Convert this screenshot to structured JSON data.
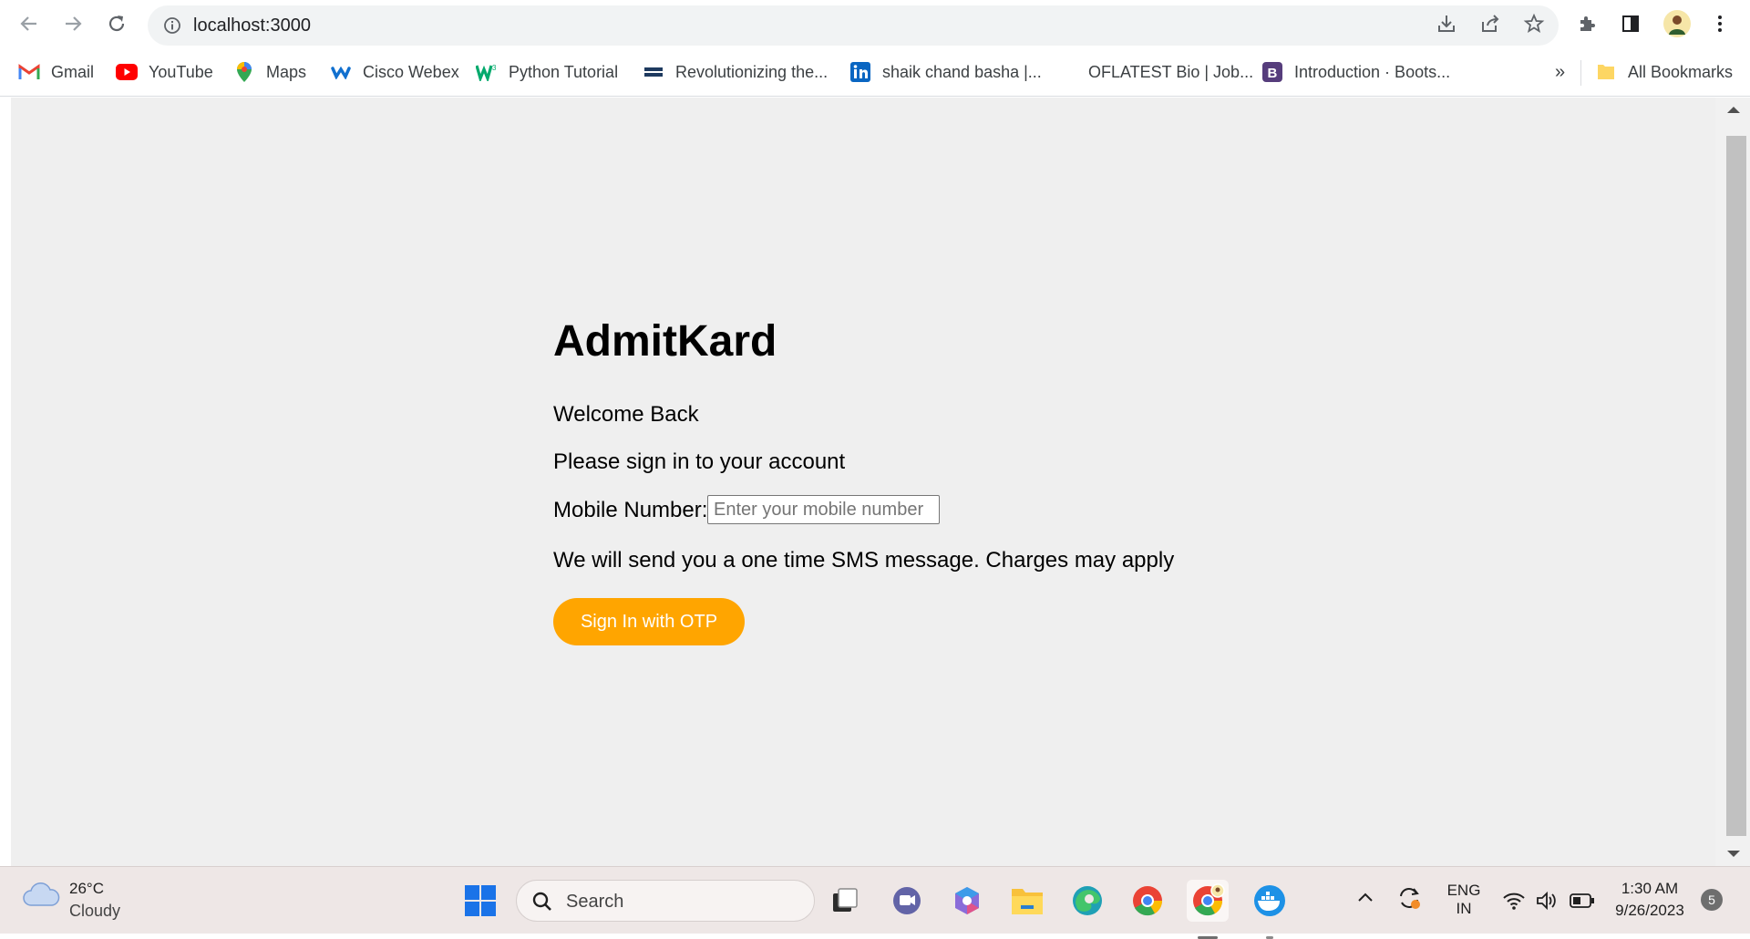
{
  "browser": {
    "url": "localhost:3000",
    "bookmarks": [
      {
        "label": "Gmail",
        "icon": "gmail-icon"
      },
      {
        "label": "YouTube",
        "icon": "youtube-icon"
      },
      {
        "label": "Maps",
        "icon": "maps-icon"
      },
      {
        "label": "Cisco Webex",
        "icon": "webex-icon"
      },
      {
        "label": "Python Tutorial",
        "icon": "w3schools-icon"
      },
      {
        "label": "Revolutionizing the...",
        "icon": "nxtwave-icon"
      },
      {
        "label": "shaik chand basha |...",
        "icon": "linkedin-icon"
      },
      {
        "label": "OFLATEST Bio | Job...",
        "icon": ""
      },
      {
        "label": "Introduction · Boots...",
        "icon": "bootstrap-icon"
      }
    ],
    "more_bookmarks": "»",
    "all_bookmarks": "All Bookmarks"
  },
  "page": {
    "title": "AdmitKard",
    "welcome": "Welcome Back",
    "subtitle": "Please sign in to your account",
    "mobile_label": "Mobile Number:",
    "mobile_value": "",
    "mobile_placeholder": "Enter your mobile number",
    "sms_note": "We will send you a one time SMS message. Charges may apply",
    "button_label": "Sign In with OTP",
    "accent_color": "#ffa500",
    "background_color": "#efefef"
  },
  "taskbar": {
    "weather_temp": "26°C",
    "weather_condition": "Cloudy",
    "search_placeholder": "Search",
    "language_line1": "ENG",
    "language_line2": "IN",
    "time": "1:30 AM",
    "date": "9/26/2023",
    "notification_count": "5"
  }
}
